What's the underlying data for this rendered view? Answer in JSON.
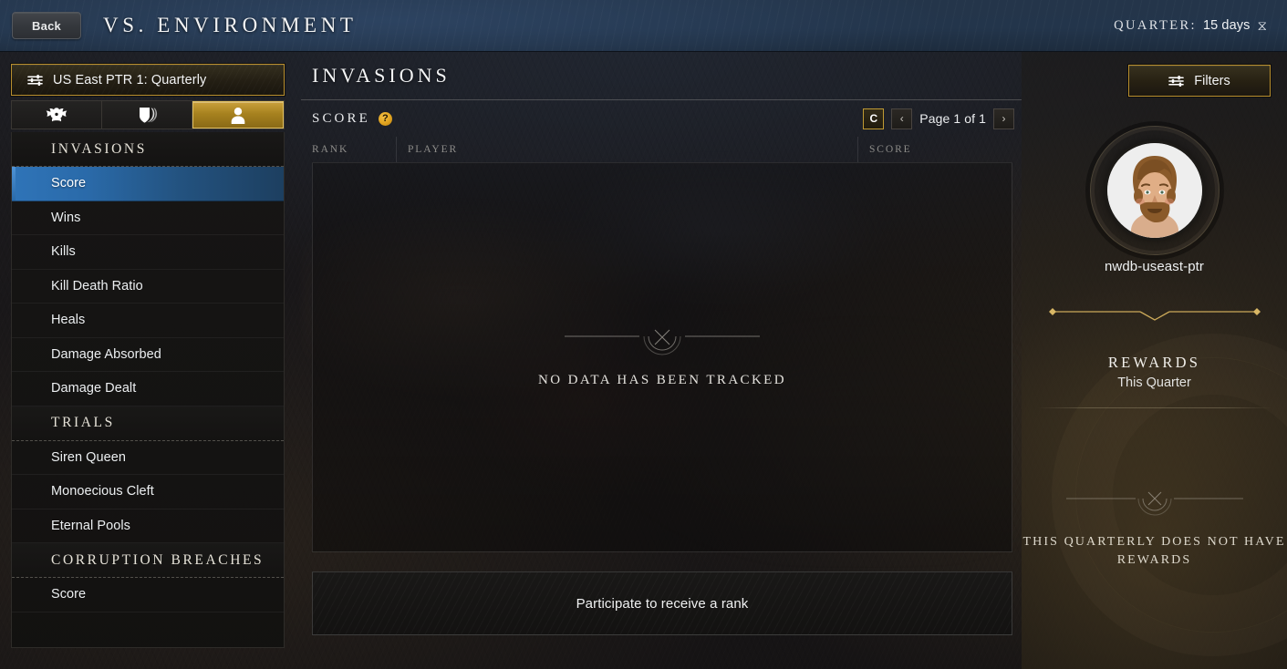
{
  "header": {
    "back_label": "Back",
    "title": "VS. ENVIRONMENT",
    "quarter_label": "QUARTER:",
    "quarter_value": "15 days",
    "hourglass_icon": "⧖"
  },
  "sidebar": {
    "server": {
      "label": "US East PTR 1: Quarterly",
      "icon": "tune-icon"
    },
    "tabs": [
      {
        "icon": "war-helm-icon",
        "selected": false
      },
      {
        "icon": "shields-icon",
        "selected": false
      },
      {
        "icon": "person-icon",
        "selected": true
      }
    ],
    "groups": [
      {
        "section": "INVASIONS",
        "items": [
          {
            "label": "Score",
            "active": true
          },
          {
            "label": "Wins",
            "active": false
          },
          {
            "label": "Kills",
            "active": false
          },
          {
            "label": "Kill Death Ratio",
            "active": false
          },
          {
            "label": "Heals",
            "active": false
          },
          {
            "label": "Damage Absorbed",
            "active": false
          },
          {
            "label": "Damage Dealt",
            "active": false
          }
        ]
      },
      {
        "section": "TRIALS",
        "items": [
          {
            "label": "Siren Queen",
            "active": false
          },
          {
            "label": "Monoecious Cleft",
            "active": false
          },
          {
            "label": "Eternal Pools",
            "active": false
          }
        ]
      },
      {
        "section": "CORRUPTION BREACHES",
        "items": [
          {
            "label": "Score",
            "active": false
          }
        ]
      }
    ]
  },
  "main": {
    "title": "INVASIONS",
    "subtitle": "SCORE",
    "help_badge": "?",
    "pager": {
      "refresh_icon": "C",
      "prev_icon": "‹",
      "next_icon": "›",
      "page_label": "Page 1 of 1"
    },
    "table": {
      "columns": [
        "RANK",
        "PLAYER",
        "SCORE"
      ],
      "rows": [],
      "empty_message": "NO DATA HAS BEEN TRACKED"
    },
    "participate_label": "Participate to receive a rank"
  },
  "filters": {
    "label": "Filters",
    "icon": "tune-icon"
  },
  "right_panel": {
    "username": "nwdb-useast-ptr",
    "avatar_icon": "avatar",
    "rewards_title": "REWARDS",
    "rewards_subtitle": "This Quarter",
    "rewards_empty_message": "THIS QUARTERLY DOES NOT HAVE REWARDS"
  },
  "colors": {
    "gold": "#b98f2e",
    "gold_bright": "#e2c163",
    "header_blue": "#23354b",
    "active_blue": "#2a6aa9",
    "help_amber": "#e0a31f"
  }
}
